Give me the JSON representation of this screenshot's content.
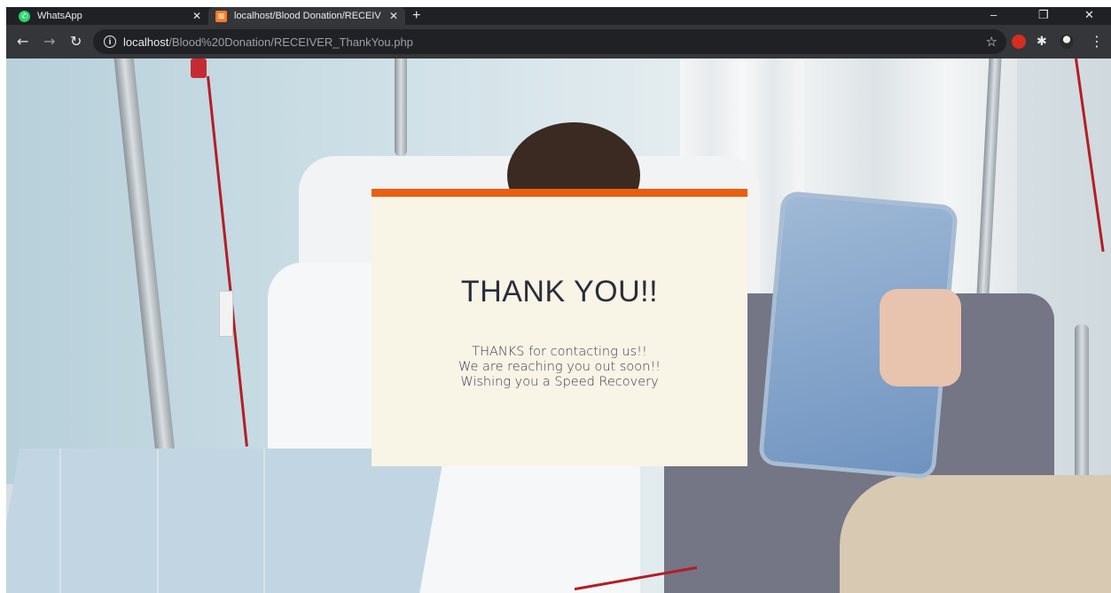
{
  "browser": {
    "tabs": [
      {
        "title": "WhatsApp",
        "icon": "whatsapp-icon"
      },
      {
        "title": "localhost/Blood Donation/RECEIV",
        "icon": "xampp-icon",
        "active": true
      }
    ],
    "new_tab": "+",
    "address": {
      "host": "localhost",
      "path": "/Blood%20Donation/RECEIVER_ThankYou.php"
    },
    "window_controls": {
      "minimize": "–",
      "maximize": "❐",
      "close": "✕"
    }
  },
  "card": {
    "accent_color": "#ea5f0f",
    "background_color": "#f8f4e6",
    "title": "THANK YOU!!",
    "lines": [
      "THANKS for contacting us!!",
      "We are reaching you out soon!!",
      "Wishing you a Speed Recovery"
    ]
  }
}
